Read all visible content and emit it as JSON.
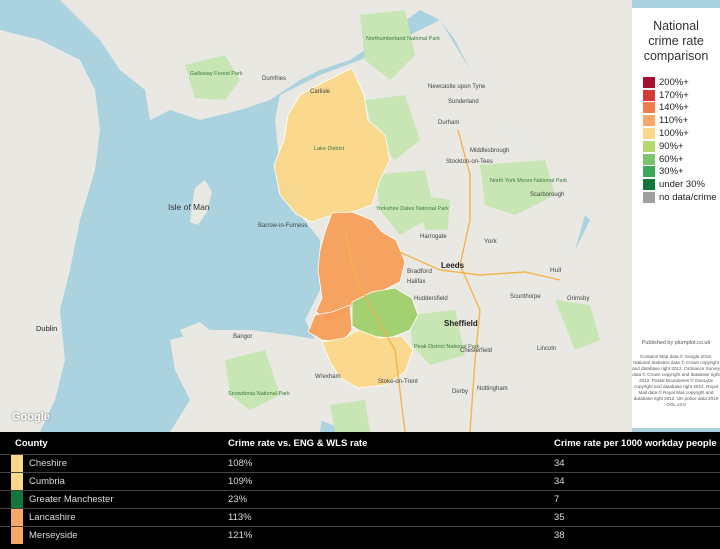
{
  "legend": {
    "title_line1": "National",
    "title_line2": "crime rate",
    "title_line3": "comparison",
    "items": [
      {
        "label": "200%+",
        "color": "#a3112e"
      },
      {
        "label": "170%+",
        "color": "#d13a36"
      },
      {
        "label": "140%+",
        "color": "#ef7d4c"
      },
      {
        "label": "110%+",
        "color": "#f9a966"
      },
      {
        "label": "100%+",
        "color": "#fbd88a"
      },
      {
        "label": "90%+",
        "color": "#b6d86e"
      },
      {
        "label": "60%+",
        "color": "#79c46b"
      },
      {
        "label": "30%+",
        "color": "#3ea85a"
      },
      {
        "label": "under 30%",
        "color": "#12753c"
      },
      {
        "label": "no data/crime",
        "color": "#a0a0a0"
      }
    ]
  },
  "attribution": {
    "published_by": "Published by plumplot.co.uk",
    "text": "Contains Map data © Google 2019. National Statistics data © Crown copyright and database right 2012. Ordnance Survey data © Crown copyright and database right 2012. Postal Boundaries © GeoLytix copyright and database right 2012. Royal Mail data © Royal Mail copyright and database right 2012. UK police data 2019 OGL v3.0"
  },
  "google_logo": "Google",
  "map": {
    "labels": {
      "isle_of_man": "Isle of Man",
      "dublin": "Dublin",
      "leeds": "Leeds",
      "sheffield": "Sheffield",
      "bradford": "Bradford",
      "york": "York",
      "dumfries": "Dumfries",
      "newcastle": "Newcastle upon Tyne",
      "middlesbrough": "Middlesbrough",
      "stockton": "Stockton-on-Tees",
      "huddersfield": "Huddersfield",
      "halifax": "Halifax",
      "hull": "Hull",
      "scunthorpe": "Scunthorpe",
      "nottingham": "Nottingham",
      "derby": "Derby",
      "stoke": "Stoke-on-Trent",
      "lincoln": "Lincoln",
      "barrow": "Barrow-in-Furness",
      "sunderland": "Sunderland",
      "durham": "Durham",
      "harrogate": "Harrogate",
      "scarborough": "Scarborough",
      "chesterfield": "Chesterfield",
      "grimsby": "Grimsby",
      "wrexham": "Wrexham",
      "bangor": "Bangor",
      "carlisle": "Carlisle",
      "peak_district": "Peak District National Park",
      "yorkshire_dales": "Yorkshire Dales National Park",
      "north_york_moors": "North York Moors National Park",
      "lake_district": "Lake District",
      "snowdonia": "Snowdonia National Park",
      "northumberland": "Northumberland National Park",
      "galloway": "Galloway Forest Park"
    }
  },
  "table": {
    "headers": {
      "county": "County",
      "rate_vs": "Crime rate vs. ENG & WLS rate",
      "per1000": "Crime rate per 1000 workday people"
    },
    "rows": [
      {
        "county": "Cheshire",
        "rate": "108%",
        "per1000": "34",
        "color": "#fbd88a"
      },
      {
        "county": "Cumbria",
        "rate": "109%",
        "per1000": "34",
        "color": "#fbd88a"
      },
      {
        "county": "Greater Manchester",
        "rate": "23%",
        "per1000": "7",
        "color": "#12753c"
      },
      {
        "county": "Lancashire",
        "rate": "113%",
        "per1000": "35",
        "color": "#f9a966"
      },
      {
        "county": "Merseyside",
        "rate": "121%",
        "per1000": "38",
        "color": "#f9a966"
      }
    ]
  }
}
